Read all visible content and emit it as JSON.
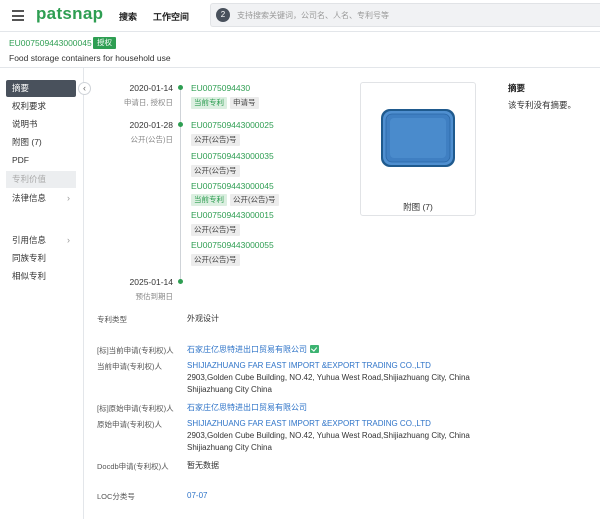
{
  "app": {
    "logo": "patsnap",
    "nav": [
      "搜索",
      "工作空间"
    ],
    "search_badge": "2",
    "search_placeholder": "支持搜索关键词，公司名、人名、专利号等"
  },
  "patent": {
    "number": "EU007509443000045",
    "status_badge": "授权",
    "title": "Food storage containers for household use"
  },
  "sidebar": {
    "items": [
      {
        "label": "摘要",
        "state": "active"
      },
      {
        "label": "权利要求",
        "state": "normal"
      },
      {
        "label": "说明书",
        "state": "normal"
      },
      {
        "label": "附图 (7)",
        "state": "normal"
      },
      {
        "label": "PDF",
        "state": "normal"
      },
      {
        "label": "专利价值",
        "state": "disabled"
      },
      {
        "label": "法律信息",
        "state": "normal",
        "chevron": "›"
      },
      {
        "label": "引用信息",
        "state": "normal",
        "chevron": "›"
      },
      {
        "label": "同族专利",
        "state": "normal"
      },
      {
        "label": "相似专利",
        "state": "normal"
      }
    ],
    "collapse_icon": "‹"
  },
  "timeline": [
    {
      "date": "2020-01-14",
      "desc": "申请日, 授权日",
      "entries": [
        {
          "number": "EU0075094430",
          "tags": [
            {
              "text": "当前专利",
              "color": "green"
            },
            {
              "text": "申请号",
              "color": "gray"
            }
          ]
        }
      ]
    },
    {
      "date": "2020-01-28",
      "desc": "公开(公告)日",
      "entries": [
        {
          "number": "EU007509443000025",
          "tags": [
            {
              "text": "公开(公告)号",
              "color": "gray"
            }
          ]
        },
        {
          "number": "EU007509443000035",
          "tags": [
            {
              "text": "公开(公告)号",
              "color": "gray"
            }
          ]
        },
        {
          "number": "EU007509443000045",
          "tags": [
            {
              "text": "当前专利",
              "color": "green"
            },
            {
              "text": "公开(公告)号",
              "color": "gray"
            }
          ]
        },
        {
          "number": "EU007509443000015",
          "tags": [
            {
              "text": "公开(公告)号",
              "color": "gray"
            }
          ]
        },
        {
          "number": "EU007509443000055",
          "tags": [
            {
              "text": "公开(公告)号",
              "color": "gray"
            }
          ]
        }
      ]
    },
    {
      "date": "2025-01-14",
      "desc": "预估到期日",
      "entries": []
    }
  ],
  "figure": {
    "label": "附图 (7)"
  },
  "abstract": {
    "title": "摘要",
    "text": "该专利没有摘要。"
  },
  "fields": {
    "patent_type": {
      "label": "专利类型",
      "value": "外观设计"
    },
    "std_current_assignee": {
      "label": "[标]当前申请(专利权)人",
      "value": "石家庄亿思特进出口贸易有限公司"
    },
    "current_assignee": {
      "label": "当前申请(专利权)人",
      "name": "SHIJIAZHUANG FAR EAST IMPORT &EXPORT TRADING CO.,LTD",
      "address_1": "2903,Golden Cube Building, NO.42, Yuhua West Road,Shijiazhuang City, China",
      "address_2": "Shijiazhuang City China"
    },
    "std_original_assignee": {
      "label": "[标]原始申请(专利权)人",
      "value": "石家庄亿思特进出口贸易有限公司"
    },
    "original_assignee": {
      "label": "原始申请(专利权)人",
      "name": "SHIJIAZHUANG FAR EAST IMPORT &EXPORT TRADING CO.,LTD",
      "address_1": "2903,Golden Cube Building, NO.42, Yuhua West Road,Shijiazhuang City, China",
      "address_2": "Shijiazhuang City China"
    },
    "docdb_assignee": {
      "label": "Docdb申请(专利权)人",
      "value": "暂无数据"
    },
    "loc_class": {
      "label": "LOC分类号",
      "value": "07-07"
    }
  }
}
